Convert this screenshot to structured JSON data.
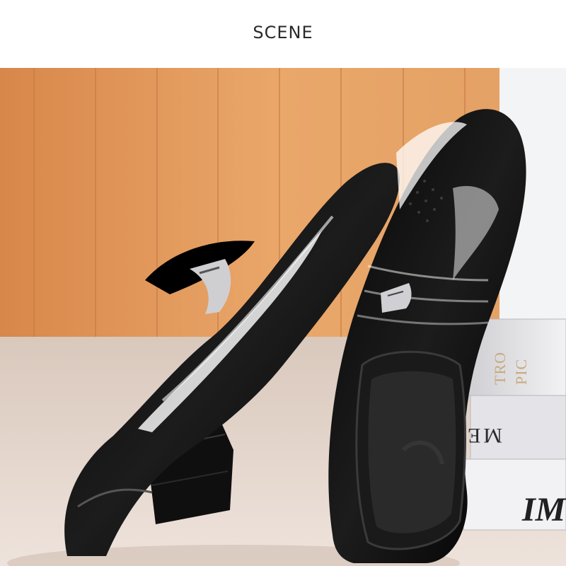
{
  "header": {
    "title": "SCENE"
  },
  "photo": {
    "subject": "pair of black patent leather slip-on dress shoes",
    "book_texts": {
      "top_spine": "TRO PIC",
      "middle": "MENT",
      "bottom": "IM"
    },
    "colors": {
      "wall": "#e09a5e",
      "floor": "#e5d8cf",
      "shoe": "#0b0b0b"
    }
  }
}
